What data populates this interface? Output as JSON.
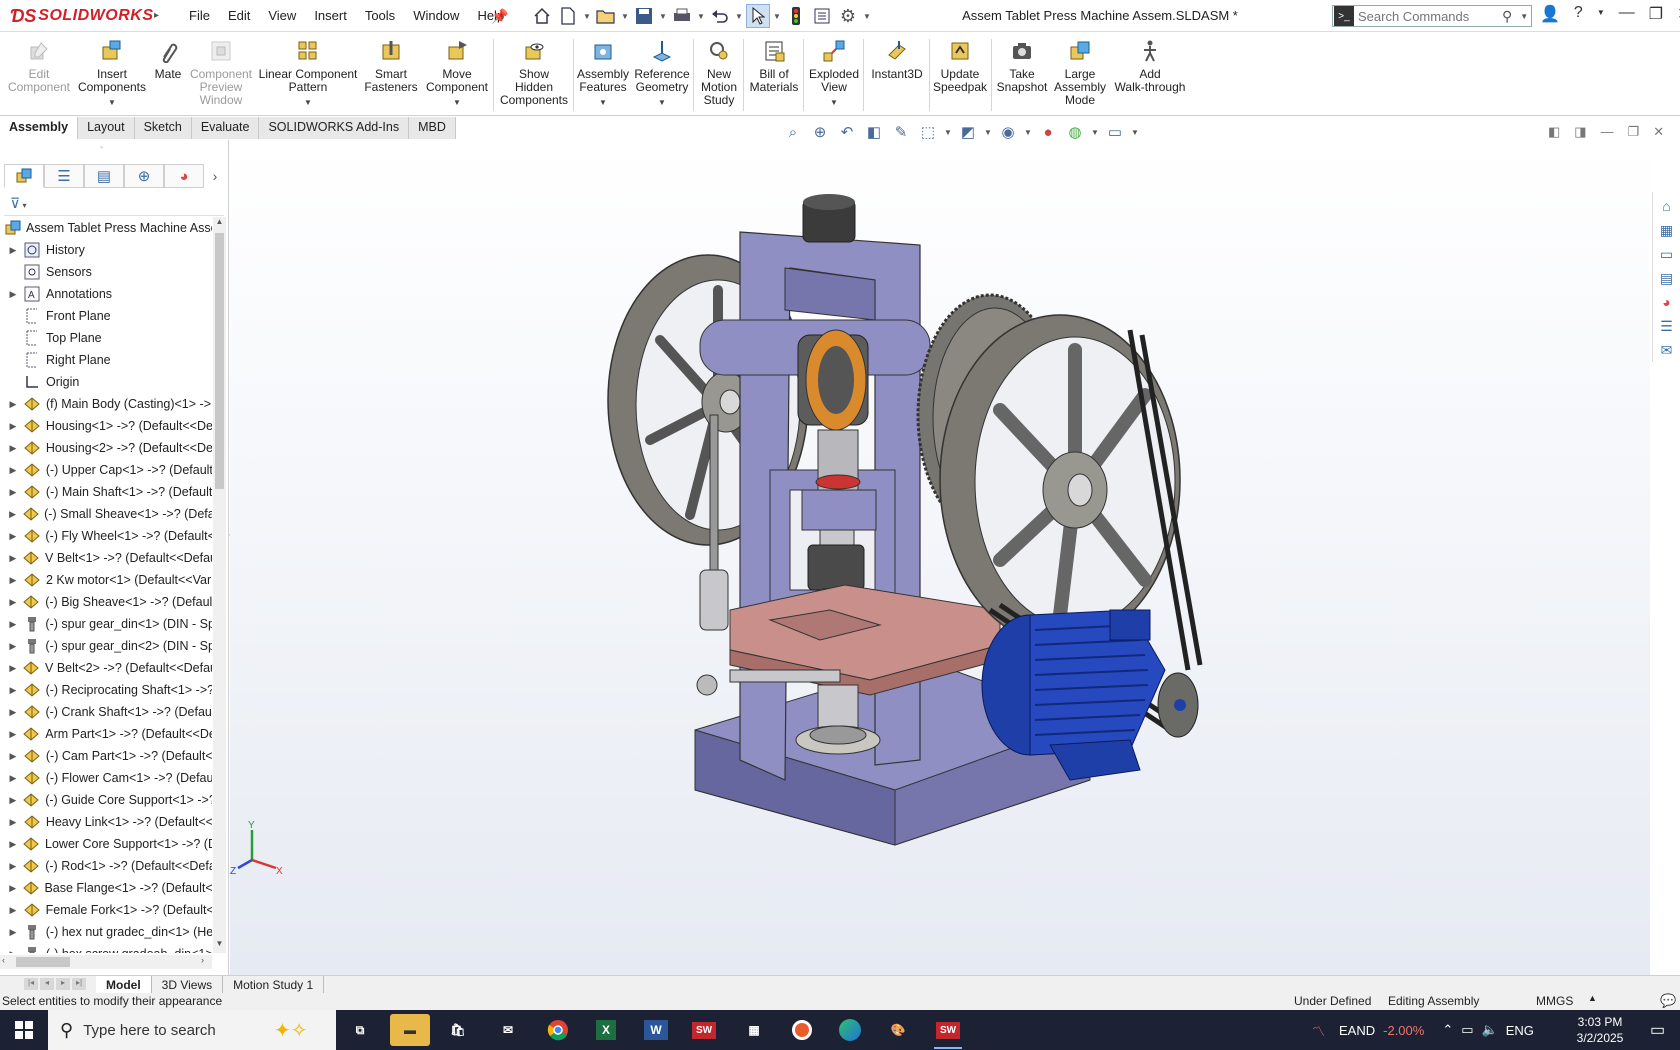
{
  "app": {
    "logo_text": "SOLIDWORKS",
    "document_title": "Assem Tablet Press Machine Assem.SLDASM *"
  },
  "menu": [
    "File",
    "Edit",
    "View",
    "Insert",
    "Tools",
    "Window",
    "Help"
  ],
  "search": {
    "placeholder": "Search Commands"
  },
  "ribbon": {
    "edit_component": "Edit\nComponent",
    "insert_components": "Insert\nComponents",
    "mate": "Mate",
    "component_preview": "Component\nPreview\nWindow",
    "linear_pattern": "Linear Component\nPattern",
    "smart_fasteners": "Smart\nFasteners",
    "move_component": "Move\nComponent",
    "show_hidden": "Show\nHidden\nComponents",
    "assembly_features": "Assembly\nFeatures",
    "reference_geometry": "Reference\nGeometry",
    "new_motion_study": "New\nMotion\nStudy",
    "bill_of_materials": "Bill of\nMaterials",
    "exploded_view": "Exploded\nView",
    "instant3d": "Instant3D",
    "update_speedpak": "Update\nSpeedpak",
    "take_snapshot": "Take\nSnapshot",
    "large_assembly_mode": "Large\nAssembly\nMode",
    "add_walkthrough": "Add\nWalk-through"
  },
  "cm_tabs": [
    "Assembly",
    "Layout",
    "Sketch",
    "Evaluate",
    "SOLIDWORKS Add-Ins",
    "MBD"
  ],
  "tree": {
    "root": "Assem Tablet Press Machine Assem",
    "items": [
      {
        "label": "History",
        "icon": "history-icon",
        "expand": true
      },
      {
        "label": "Sensors",
        "icon": "sensor-icon",
        "expand": false
      },
      {
        "label": "Annotations",
        "icon": "annotation-icon",
        "expand": true
      },
      {
        "label": "Front Plane",
        "icon": "plane-icon",
        "expand": false
      },
      {
        "label": "Top Plane",
        "icon": "plane-icon",
        "expand": false
      },
      {
        "label": "Right Plane",
        "icon": "plane-icon",
        "expand": false
      },
      {
        "label": "Origin",
        "icon": "origin-icon",
        "expand": false
      },
      {
        "label": "(f) Main Body (Casting)<1> ->",
        "icon": "part-icon",
        "expand": true
      },
      {
        "label": "Housing<1> ->? (Default<<De",
        "icon": "part-icon",
        "expand": true
      },
      {
        "label": "Housing<2> ->? (Default<<De",
        "icon": "part-icon",
        "expand": true
      },
      {
        "label": "(-) Upper Cap<1> ->? (Default",
        "icon": "part-icon",
        "expand": true
      },
      {
        "label": "(-) Main Shaft<1> ->? (Default",
        "icon": "part-icon",
        "expand": true
      },
      {
        "label": "(-) Small Sheave<1> ->? (Defau",
        "icon": "part-icon",
        "expand": true
      },
      {
        "label": "(-) Fly Wheel<1> ->? (Default<",
        "icon": "part-icon",
        "expand": true
      },
      {
        "label": "V Belt<1> ->? (Default<<Defau",
        "icon": "part-icon",
        "expand": true
      },
      {
        "label": "2 Kw motor<1> (Default<<Var",
        "icon": "part-icon",
        "expand": true
      },
      {
        "label": "(-) Big Sheave<1> ->? (Default",
        "icon": "part-icon",
        "expand": true
      },
      {
        "label": "(-) spur gear_din<1> (DIN - Sp",
        "icon": "toolbox-icon",
        "expand": true
      },
      {
        "label": "(-) spur gear_din<2> (DIN - Sp",
        "icon": "toolbox-icon",
        "expand": true
      },
      {
        "label": "V Belt<2> ->? (Default<<Defau",
        "icon": "part-icon",
        "expand": true
      },
      {
        "label": "(-) Reciprocating Shaft<1> ->?",
        "icon": "part-icon",
        "expand": true
      },
      {
        "label": "(-) Crank Shaft<1> ->? (Defaul",
        "icon": "part-icon",
        "expand": true
      },
      {
        "label": "Arm Part<1> ->? (Default<<De",
        "icon": "part-icon",
        "expand": true
      },
      {
        "label": "(-) Cam Part<1> ->? (Default<",
        "icon": "part-icon",
        "expand": true
      },
      {
        "label": "(-) Flower Cam<1> ->? (Defau",
        "icon": "part-icon",
        "expand": true
      },
      {
        "label": "(-) Guide Core Support<1> ->?",
        "icon": "part-icon",
        "expand": true
      },
      {
        "label": "Heavy Link<1> ->? (Default<<",
        "icon": "part-icon",
        "expand": true
      },
      {
        "label": "Lower Core Support<1> ->? (D",
        "icon": "part-icon",
        "expand": true
      },
      {
        "label": "(-) Rod<1> ->? (Default<<Defa",
        "icon": "part-icon",
        "expand": true
      },
      {
        "label": "Base Flange<1> ->? (Default<<",
        "icon": "part-icon",
        "expand": true
      },
      {
        "label": "Female Fork<1> ->? (Default<",
        "icon": "part-icon",
        "expand": true
      },
      {
        "label": "(-) hex nut gradec_din<1> (He",
        "icon": "toolbox-icon",
        "expand": true
      },
      {
        "label": "(-) hex screw gradeab_din<1>",
        "icon": "toolbox-icon",
        "expand": true
      }
    ]
  },
  "bottom_tabs": [
    "Model",
    "3D Views",
    "Motion Study 1"
  ],
  "status": {
    "message": "Select entities to modify their appearance",
    "definition": "Under Defined",
    "mode": "Editing Assembly",
    "units": "MMGS"
  },
  "taskbar": {
    "search_placeholder": "Type here to search",
    "ticker": "EAND",
    "change": "-2.00%",
    "language": "ENG",
    "time": "3:03 PM",
    "date": "3/2/2025",
    "apps": [
      "task-view",
      "file-explorer",
      "store",
      "mail",
      "chrome",
      "excel",
      "word",
      "solidworks-2019",
      "calculator",
      "recorder",
      "edge",
      "paint",
      "solidworks-2019-active"
    ]
  },
  "triad": {
    "x": "X",
    "y": "Y",
    "z": "Z"
  },
  "colors": {
    "frame": "#8f8fc4",
    "frame_dark": "#6767a0",
    "wheel": "#8a8880",
    "motor": "#1f3fa8",
    "plate": "#c98f8a",
    "accent_red": "#d32027",
    "cam_orange": "#d98a2c"
  }
}
